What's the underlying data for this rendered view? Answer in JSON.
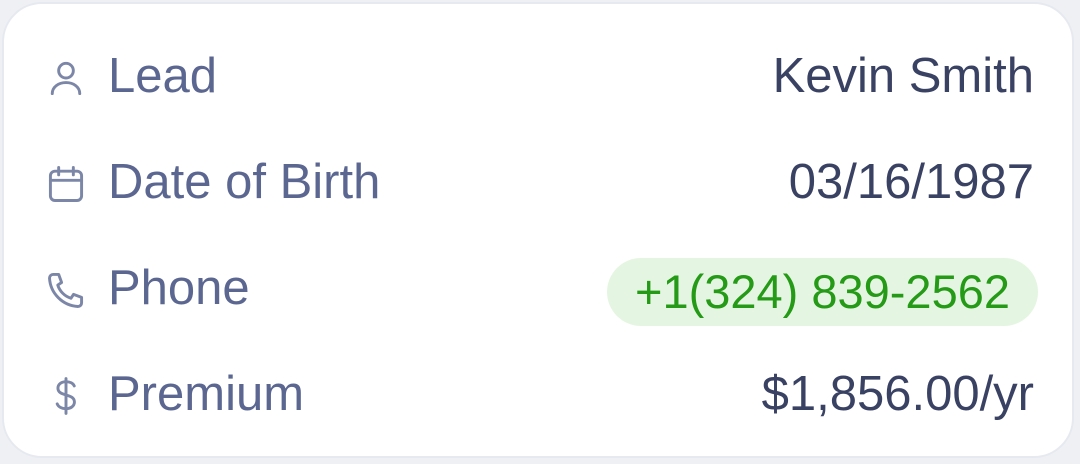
{
  "colors": {
    "label": "#5b6790",
    "value": "#3a4263",
    "phone_text": "#249a17",
    "phone_bg": "#e4f6e1",
    "icon": "#7c87a8"
  },
  "fields": [
    {
      "icon": "user-icon",
      "label": "Lead",
      "value": "Kevin Smith"
    },
    {
      "icon": "calendar-icon",
      "label": "Date of Birth",
      "value": "03/16/1987"
    },
    {
      "icon": "phone-icon",
      "label": "Phone",
      "value": "+1(324) 839-2562"
    },
    {
      "icon": "dollar-icon",
      "label": "Premium",
      "value": "$1,856.00/yr"
    }
  ]
}
